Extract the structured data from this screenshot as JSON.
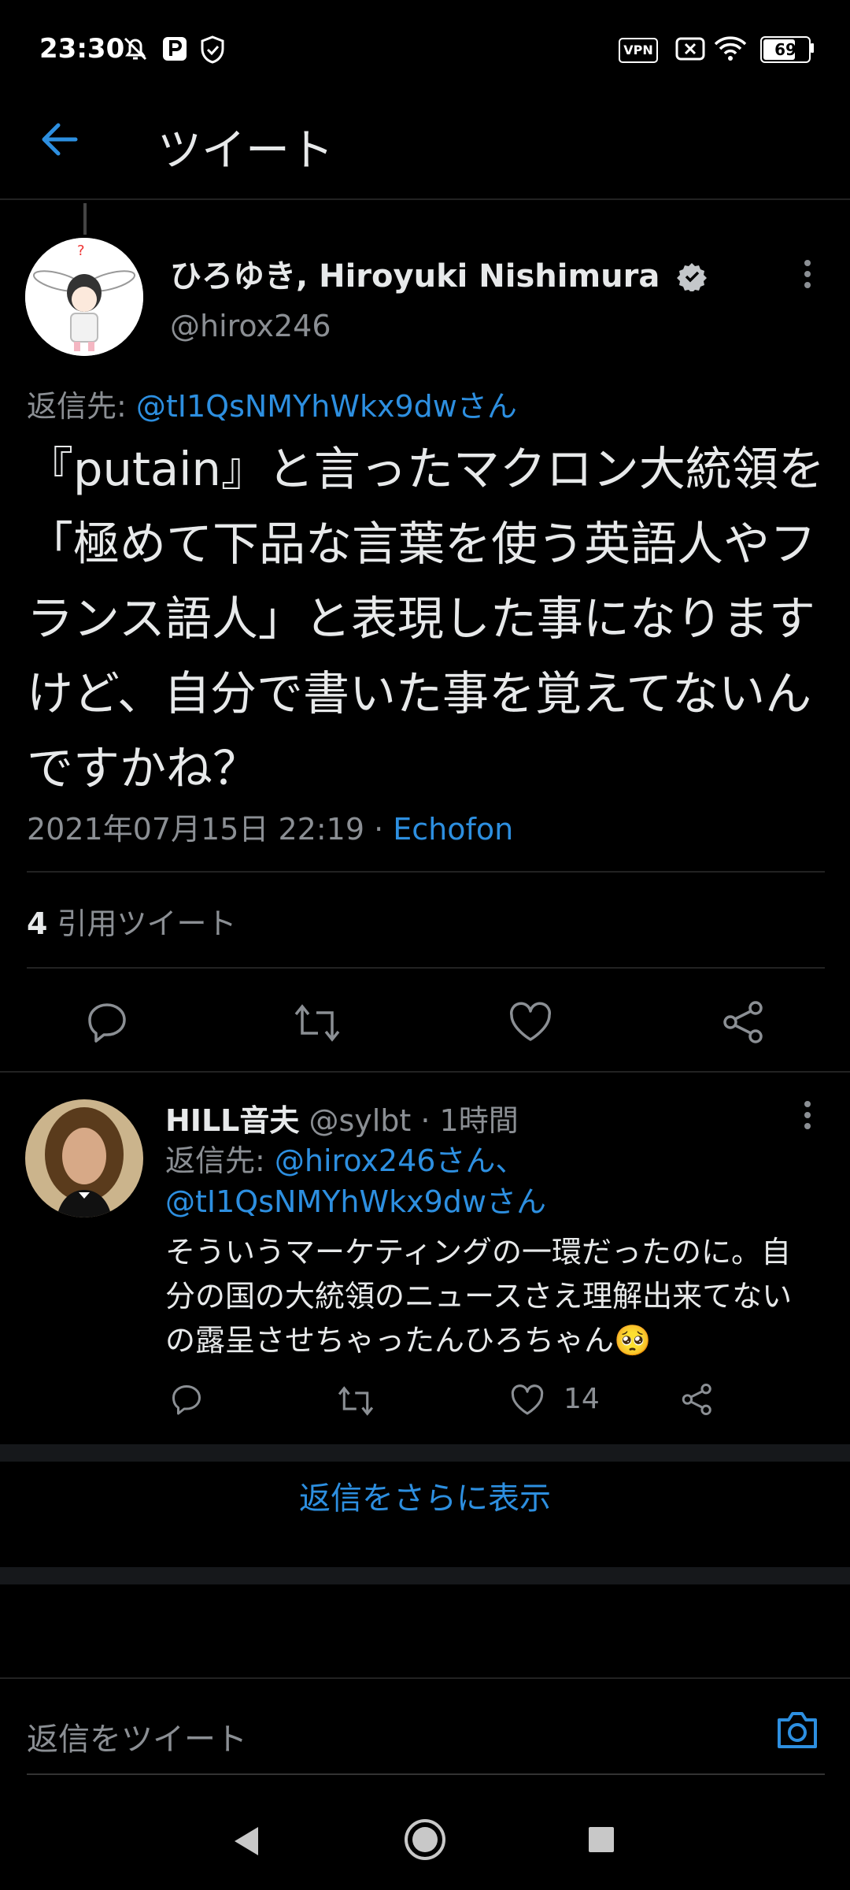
{
  "status_bar": {
    "time": "23:30",
    "vpn": "VPN",
    "battery": "69"
  },
  "header": {
    "title": "ツイート"
  },
  "tweet": {
    "display_name": "ひろゆき, Hiroyuki Nishimura",
    "handle": "@hirox246",
    "reply_prefix": "返信先: ",
    "reply_to": "@tI1QsNMYhWkx9dwさん",
    "text": "『putain』と言ったマクロン大統領を「極めて下品な言葉を使う英語人やフランス語人」と表現した事になりますけど、自分で書いた事を覚えてないんですかね？",
    "timestamp": "2021年07月15日 22:19 · ",
    "client": "Echofon",
    "quote_count": "4",
    "quote_label": " 引用ツイート"
  },
  "reply": {
    "display_name": "HILL音夫",
    "meta": " @sylbt · 1時間",
    "reply_prefix": "返信先: ",
    "reply_to_line1": "@hirox246さん、",
    "reply_to_line2": "@tI1QsNMYhWkx9dwさん",
    "text": "そういうマーケティングの一環だったのに。自分の国の大統領のニュースさえ理解出来てないの露呈させちゃったんひろちゃん🥺",
    "like_count": "14"
  },
  "more_replies_label": "返信をさらに表示",
  "compose": {
    "placeholder": "返信をツイート"
  },
  "colors": {
    "accent": "#2d8fe0",
    "background": "#000000",
    "muted": "#8b8f94"
  }
}
